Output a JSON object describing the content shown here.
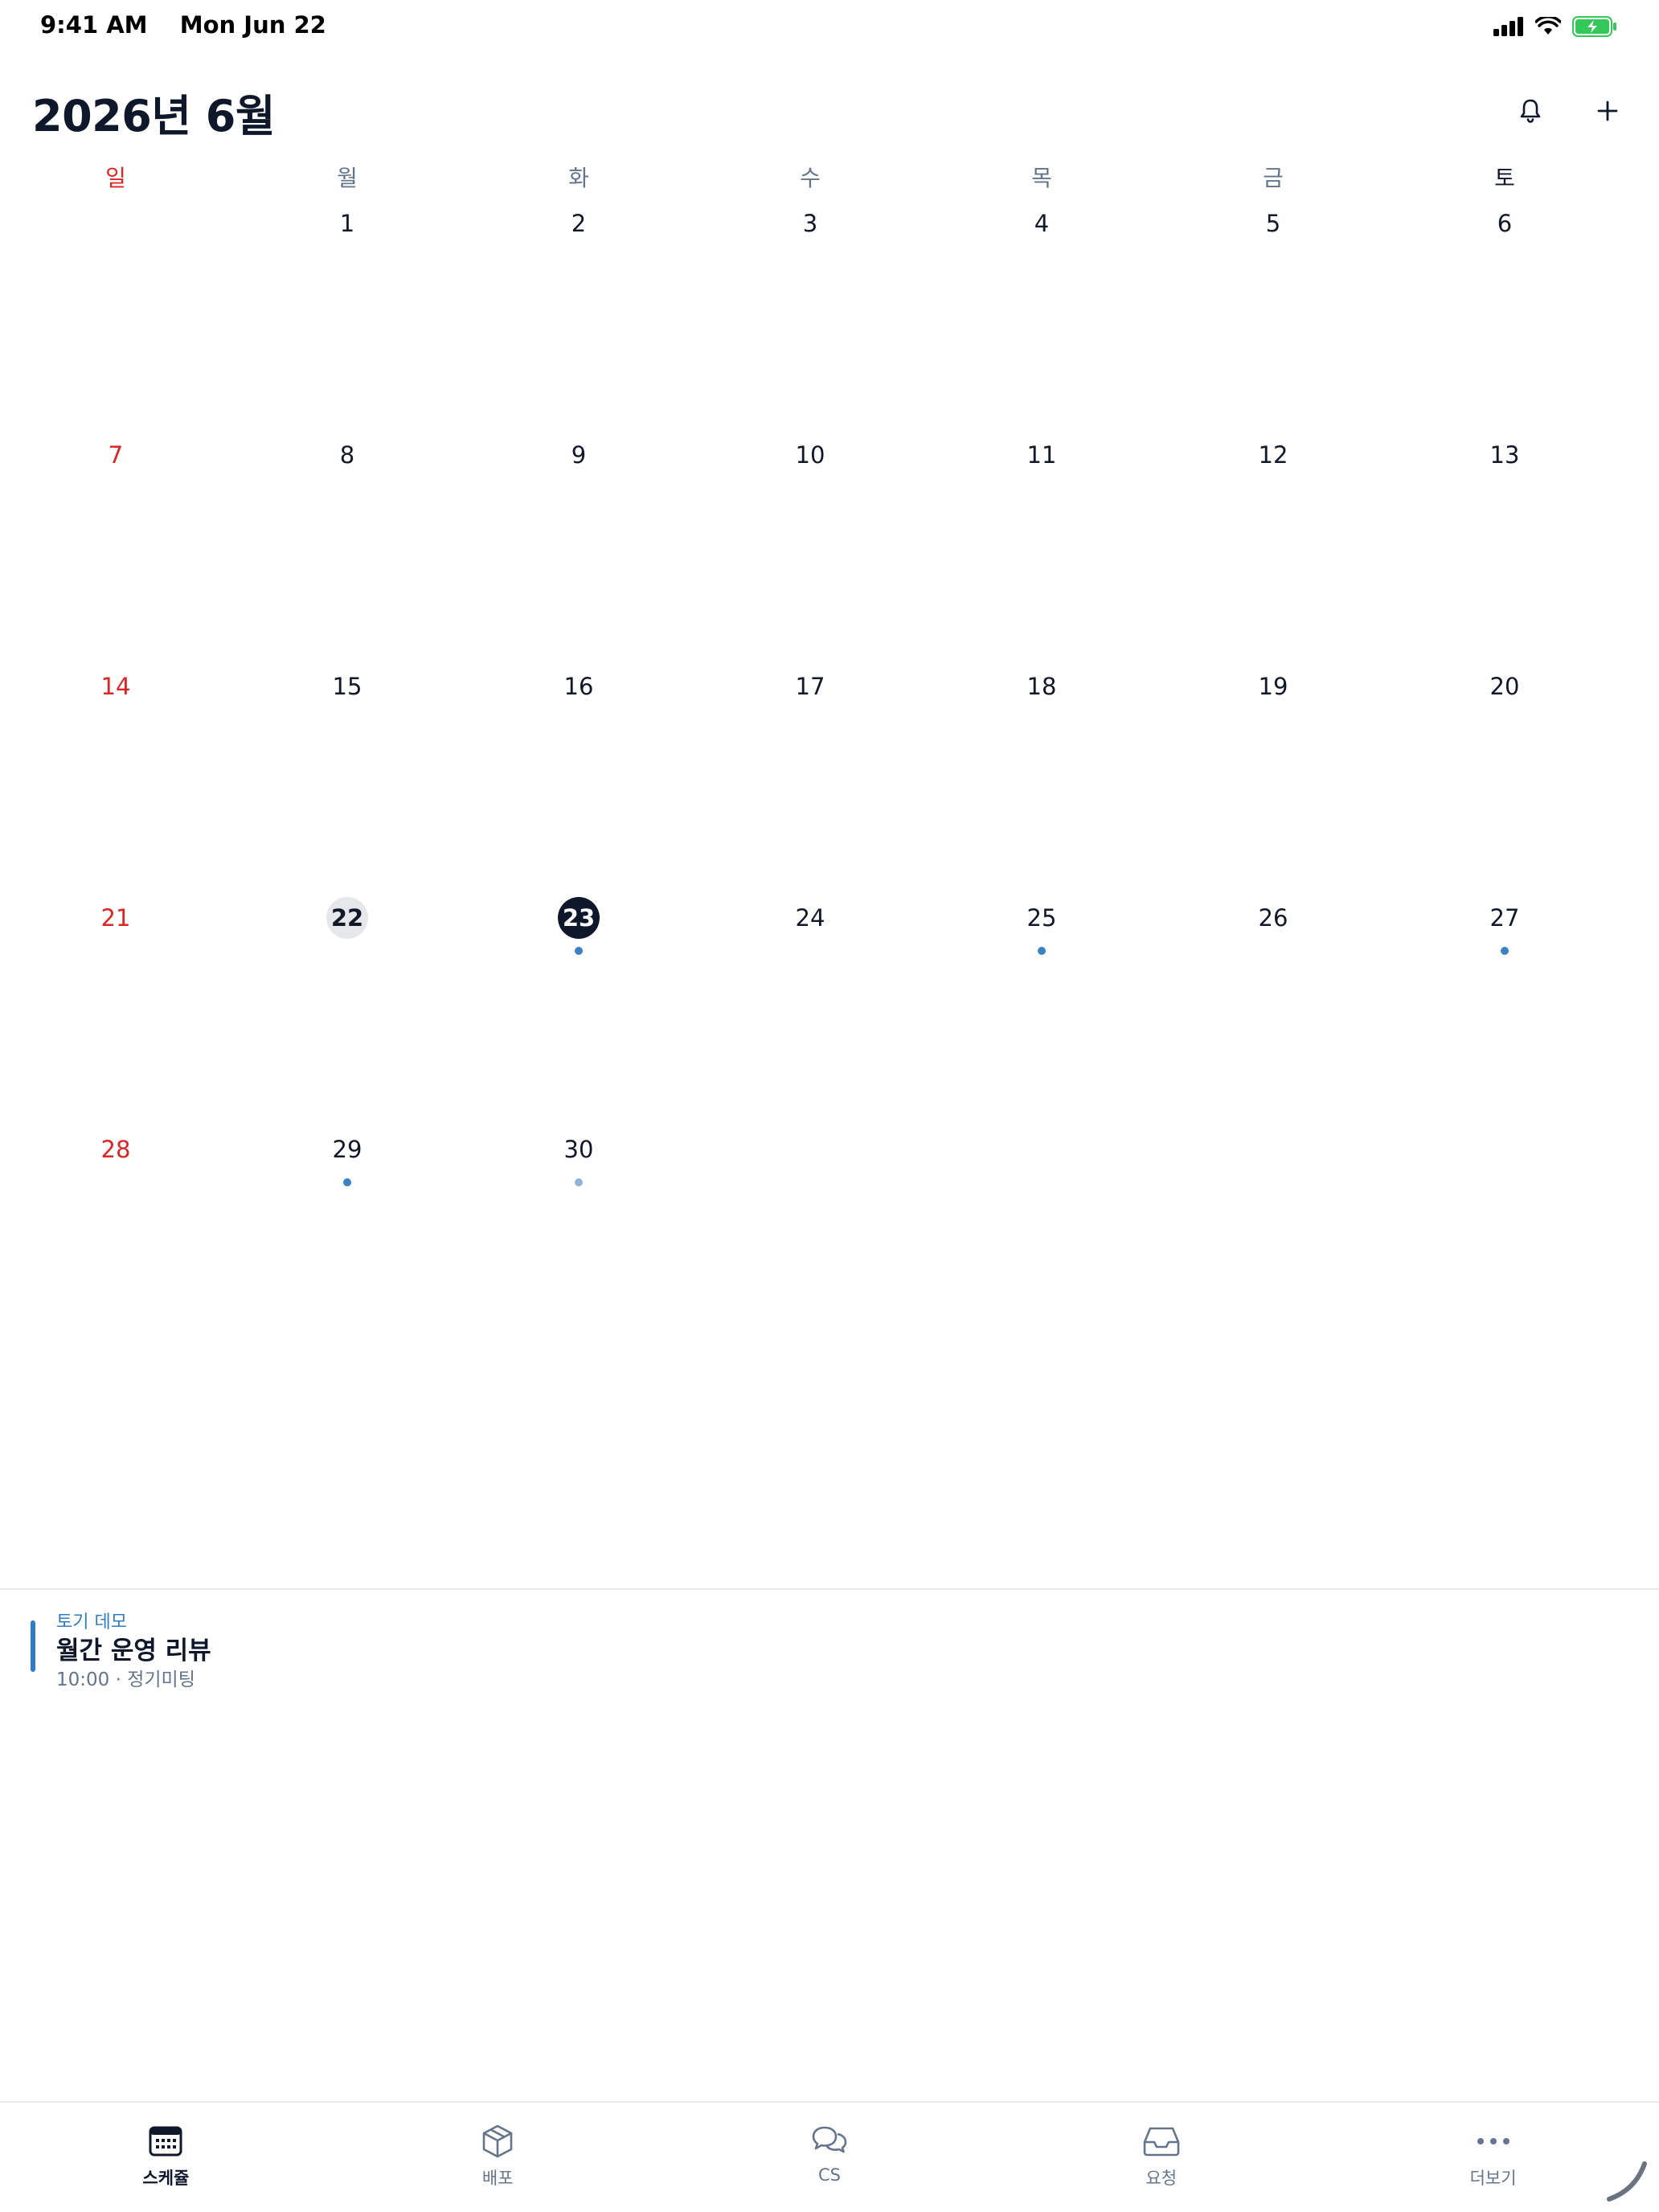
{
  "status_bar": {
    "time": "9:41 AM",
    "date": "Mon Jun 22",
    "icons": [
      "cellular-signal-icon",
      "wifi-icon",
      "battery-charging-icon"
    ],
    "battery_color": "#34c759"
  },
  "header": {
    "title": "2026년 6월",
    "actions": [
      "bell-icon",
      "plus-icon"
    ]
  },
  "weekdays": [
    "일",
    "월",
    "화",
    "수",
    "목",
    "금",
    "토"
  ],
  "calendar": {
    "today": "22",
    "selected": "23",
    "weeks": [
      [
        {
          "day": "",
          "dot": "none"
        },
        {
          "day": "1",
          "dot": "none"
        },
        {
          "day": "2",
          "dot": "none"
        },
        {
          "day": "3",
          "dot": "none"
        },
        {
          "day": "4",
          "dot": "none"
        },
        {
          "day": "5",
          "dot": "none"
        },
        {
          "day": "6",
          "dot": "none"
        }
      ],
      [
        {
          "day": "7",
          "dot": "none"
        },
        {
          "day": "8",
          "dot": "none"
        },
        {
          "day": "9",
          "dot": "none"
        },
        {
          "day": "10",
          "dot": "none"
        },
        {
          "day": "11",
          "dot": "none"
        },
        {
          "day": "12",
          "dot": "none"
        },
        {
          "day": "13",
          "dot": "none"
        }
      ],
      [
        {
          "day": "14",
          "dot": "none"
        },
        {
          "day": "15",
          "dot": "none"
        },
        {
          "day": "16",
          "dot": "none"
        },
        {
          "day": "17",
          "dot": "none"
        },
        {
          "day": "18",
          "dot": "none"
        },
        {
          "day": "19",
          "dot": "none"
        },
        {
          "day": "20",
          "dot": "none"
        }
      ],
      [
        {
          "day": "21",
          "dot": "none"
        },
        {
          "day": "22",
          "dot": "none"
        },
        {
          "day": "23",
          "dot": "blue"
        },
        {
          "day": "24",
          "dot": "none"
        },
        {
          "day": "25",
          "dot": "blue"
        },
        {
          "day": "26",
          "dot": "none"
        },
        {
          "day": "27",
          "dot": "blue"
        }
      ],
      [
        {
          "day": "28",
          "dot": "none"
        },
        {
          "day": "29",
          "dot": "blue"
        },
        {
          "day": "30",
          "dot": "light"
        },
        {
          "day": "",
          "dot": "none"
        },
        {
          "day": "",
          "dot": "none"
        },
        {
          "day": "",
          "dot": "none"
        },
        {
          "day": "",
          "dot": "none"
        }
      ]
    ],
    "colors": {
      "sunday": "#dc2626",
      "selected_bg": "#0f172a",
      "today_bg": "#e5e7eb",
      "dot": "#3b82c4",
      "dot_light": "#8fb4d6"
    }
  },
  "events": [
    {
      "tag": "토기 데모",
      "title": "월간 운영 리뷰",
      "meta": "10:00 · 정기미팅",
      "color": "#2f7bc4"
    }
  ],
  "tabs": [
    {
      "label": "스케쥴",
      "icon": "calendar-icon",
      "active": true
    },
    {
      "label": "배포",
      "icon": "package-icon",
      "active": false
    },
    {
      "label": "CS",
      "icon": "chat-bubbles-icon",
      "active": false
    },
    {
      "label": "요청",
      "icon": "inbox-icon",
      "active": false
    },
    {
      "label": "더보기",
      "icon": "more-dots-icon",
      "active": false
    }
  ]
}
